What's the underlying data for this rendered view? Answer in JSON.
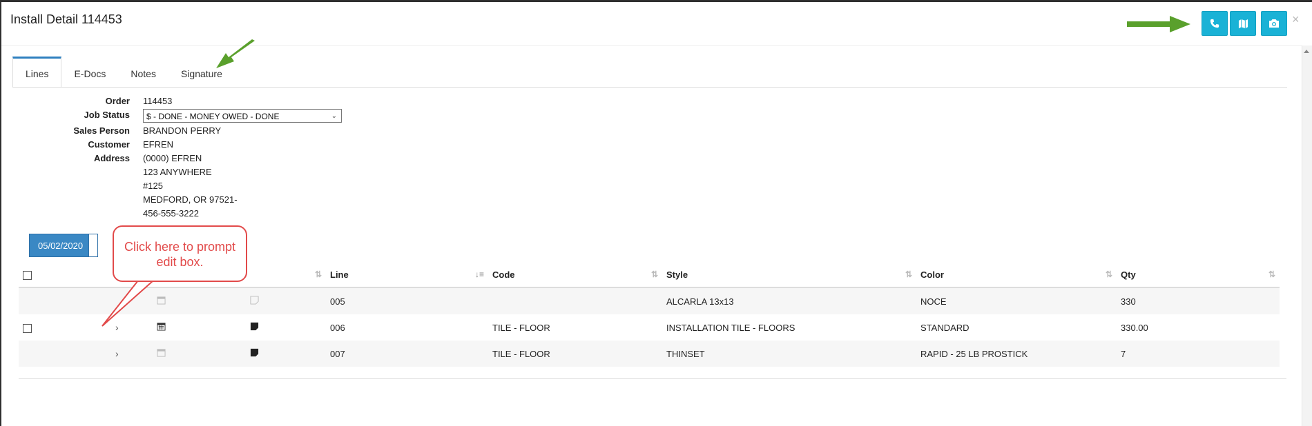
{
  "header": {
    "title": "Install Detail 114453",
    "buttons": [
      {
        "name": "phone",
        "icon": "phone-icon"
      },
      {
        "name": "map",
        "icon": "map-icon"
      },
      {
        "name": "camera",
        "icon": "camera-icon"
      }
    ],
    "close_label": "×",
    "accent_color": "#1ab2d6"
  },
  "tabs": [
    {
      "label": "Lines",
      "active": true
    },
    {
      "label": "E-Docs",
      "active": false
    },
    {
      "label": "Notes",
      "active": false
    },
    {
      "label": "Signature",
      "active": false
    }
  ],
  "details": {
    "order_label": "Order",
    "order_value": "114453",
    "status_label": "Job Status",
    "status_value": "$ - DONE - MONEY OWED - DONE",
    "sales_label": "Sales Person",
    "sales_value": "BRANDON PERRY",
    "customer_label": "Customer",
    "customer_value": "EFREN",
    "address_label": "Address",
    "address_lines": [
      "(0000) EFREN",
      "123 ANYWHERE",
      "#125",
      "MEDFORD, OR 97521-",
      "456-555-3222"
    ]
  },
  "date_button": "05/02/2020",
  "callout": "Click here to prompt edit box.",
  "table": {
    "columns": [
      "Line",
      "Code",
      "Style",
      "Color",
      "Qty"
    ],
    "rows": [
      {
        "line": "005",
        "code": "",
        "style": "ALCARLA 13x13",
        "color": "NOCE",
        "qty": "330",
        "has_checkbox": false,
        "has_chevron": false
      },
      {
        "line": "006",
        "code": "TILE - FLOOR",
        "style": "INSTALLATION TILE - FLOORS",
        "color": "STANDARD",
        "qty": "330.00",
        "has_checkbox": true,
        "has_chevron": true
      },
      {
        "line": "007",
        "code": "TILE - FLOOR",
        "style": "THINSET",
        "color": "RAPID - 25 LB PROSTICK",
        "qty": "7",
        "has_checkbox": false,
        "has_chevron": true
      }
    ]
  },
  "annotation_colors": {
    "arrow": "#5aa02c",
    "callout": "#e24a4a"
  }
}
